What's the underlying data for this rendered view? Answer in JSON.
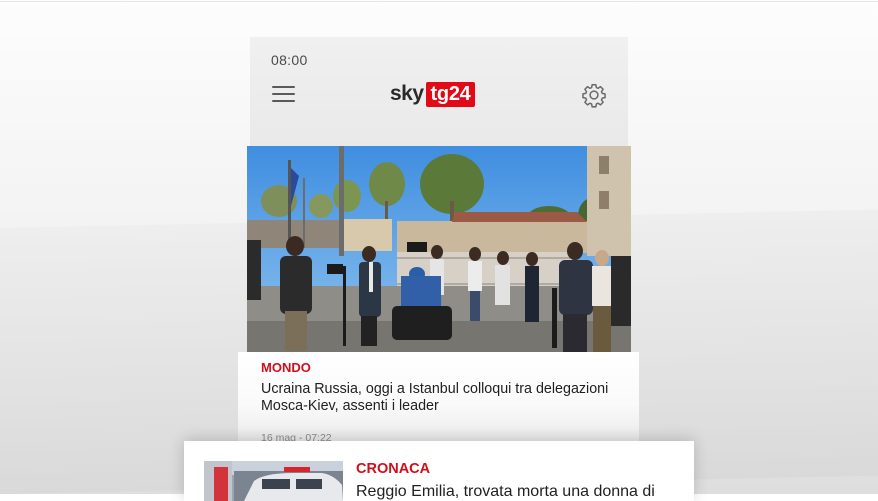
{
  "status": {
    "time": "08:00"
  },
  "header": {
    "logo_sky": "sky",
    "logo_tg": "tg24",
    "menu_icon": "hamburger-menu-icon",
    "settings_icon": "gear-icon"
  },
  "articles": [
    {
      "category": "MONDO",
      "headline": "Ucraina Russia, oggi a Istanbul colloqui tra delegazioni Mosca-Kiev, assenti i leader",
      "date": "16 mag - 07:22"
    },
    {
      "category": "CRONACA",
      "headline": "Reggio Emilia, trovata morta una donna di"
    }
  ],
  "colors": {
    "brand_red": "#e20a17",
    "category_red": "#d00f1c"
  }
}
